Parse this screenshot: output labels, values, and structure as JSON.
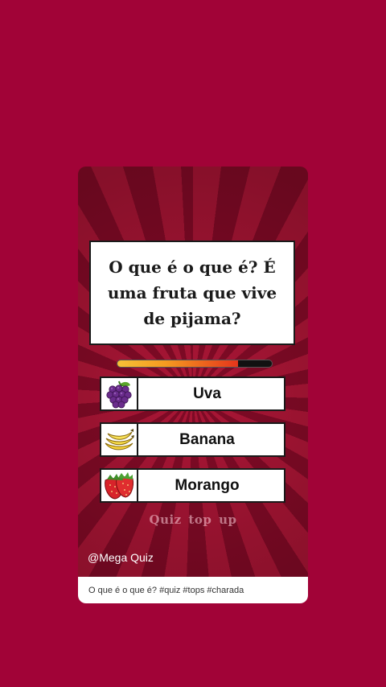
{
  "page": {
    "background": "#a10337"
  },
  "video": {
    "question": "O que é o que é? É uma fruta que vive de pijama?",
    "timer_fraction_remaining": 0.78,
    "options": [
      {
        "label": "Uva",
        "icon": "grapes-icon"
      },
      {
        "label": "Banana",
        "icon": "banana-icon"
      },
      {
        "label": "Morango",
        "icon": "strawberry-icon"
      }
    ],
    "watermark": "Quiz top up",
    "handle": "@Mega Quiz"
  },
  "caption": "O que é o que é? #quiz #tops #charada",
  "colors": {
    "ray_light": "#a51534",
    "ray_dark": "#7d0a25",
    "timer_start": "#f7c136",
    "timer_end": "#e5351b"
  }
}
